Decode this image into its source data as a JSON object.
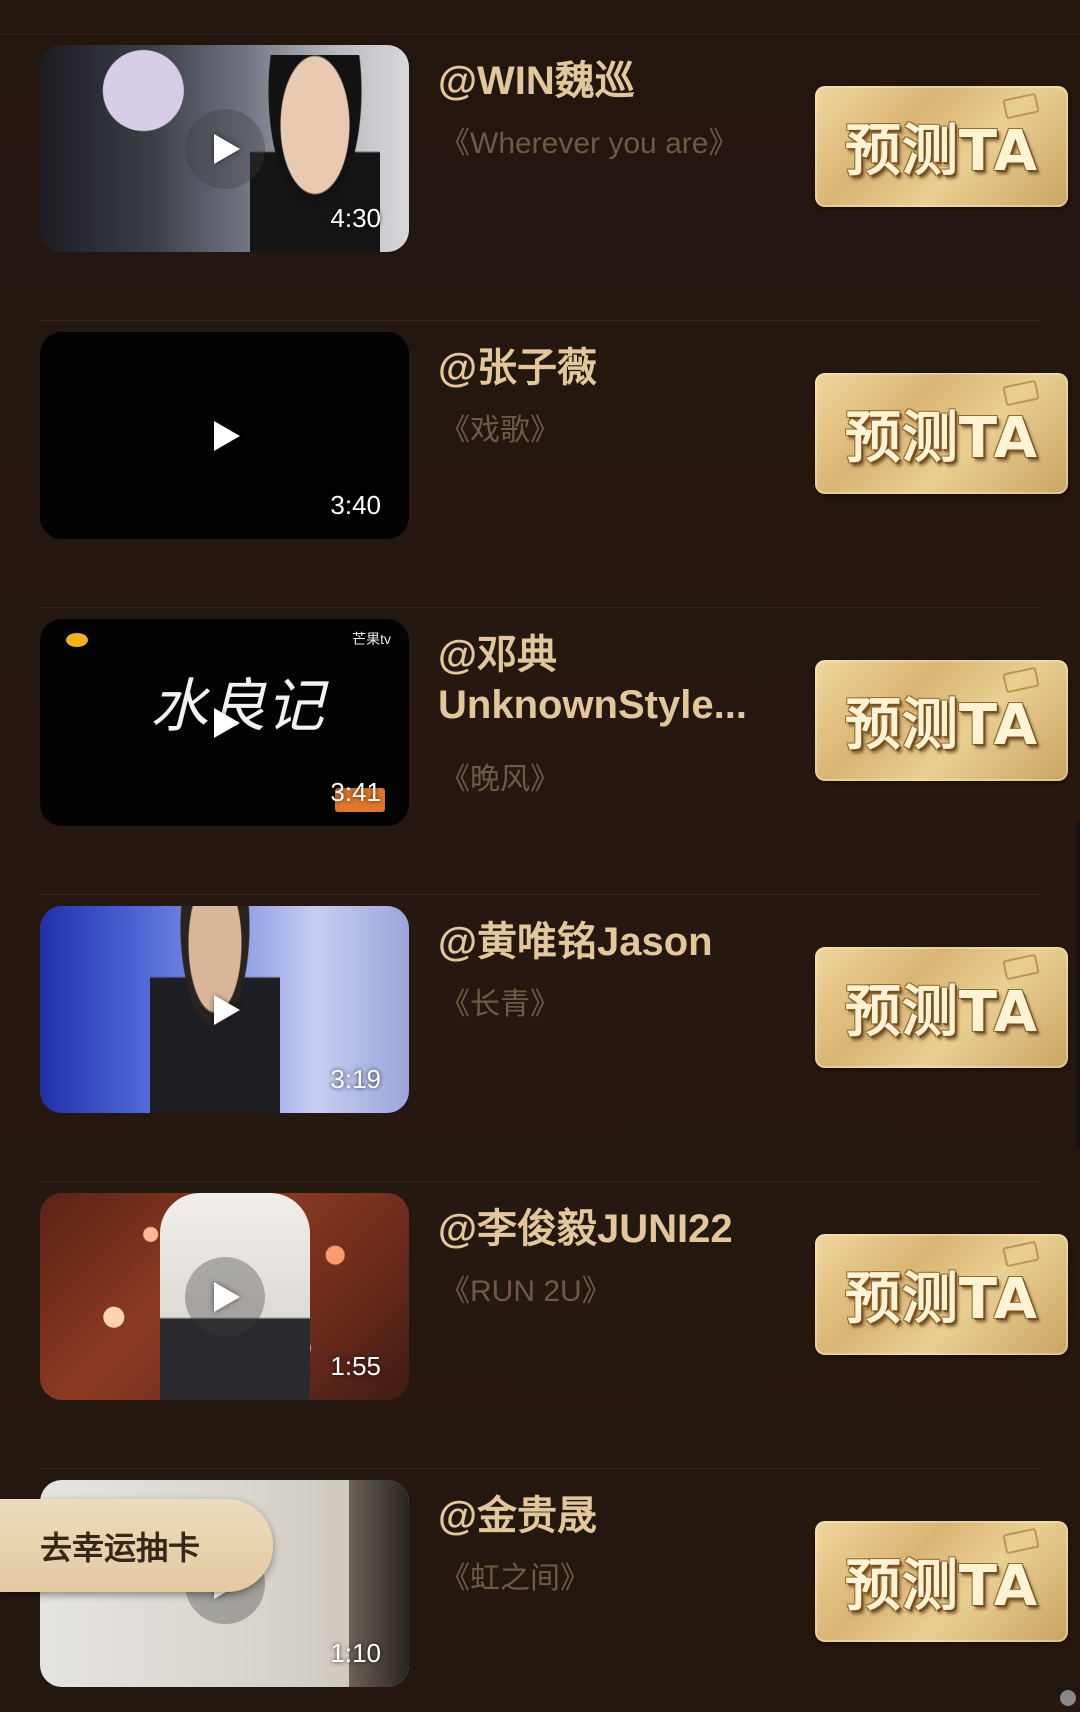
{
  "items": [
    {
      "name": "@WIN魏巡",
      "song": "《Wherever you are》",
      "duration": "4:30",
      "button": "预测TA"
    },
    {
      "name": "@张子薇",
      "song": "《戏歌》",
      "duration": "3:40",
      "button": "预测TA"
    },
    {
      "name": "@邓典UnknownStyle...",
      "song": "《晚风》",
      "duration": "3:41",
      "button": "预测TA",
      "thumb_brand": "芒果tv",
      "thumb_title": "水良记"
    },
    {
      "name": "@黄唯铭Jason",
      "song": "《长青》",
      "duration": "3:19",
      "button": "预测TA"
    },
    {
      "name": "@李俊毅JUNI22",
      "song": "《RUN 2U》",
      "duration": "1:55",
      "button": "预测TA"
    },
    {
      "name": "@金贵晟",
      "song": "《虹之间》",
      "duration": "1:10",
      "button": "预测TA"
    }
  ],
  "floating_button": {
    "label": "去幸运抽卡"
  },
  "colors": {
    "background": "#241711",
    "name_text": "#e2c79a",
    "song_text": "#6e5a46",
    "gold_button": "#d8b574"
  }
}
